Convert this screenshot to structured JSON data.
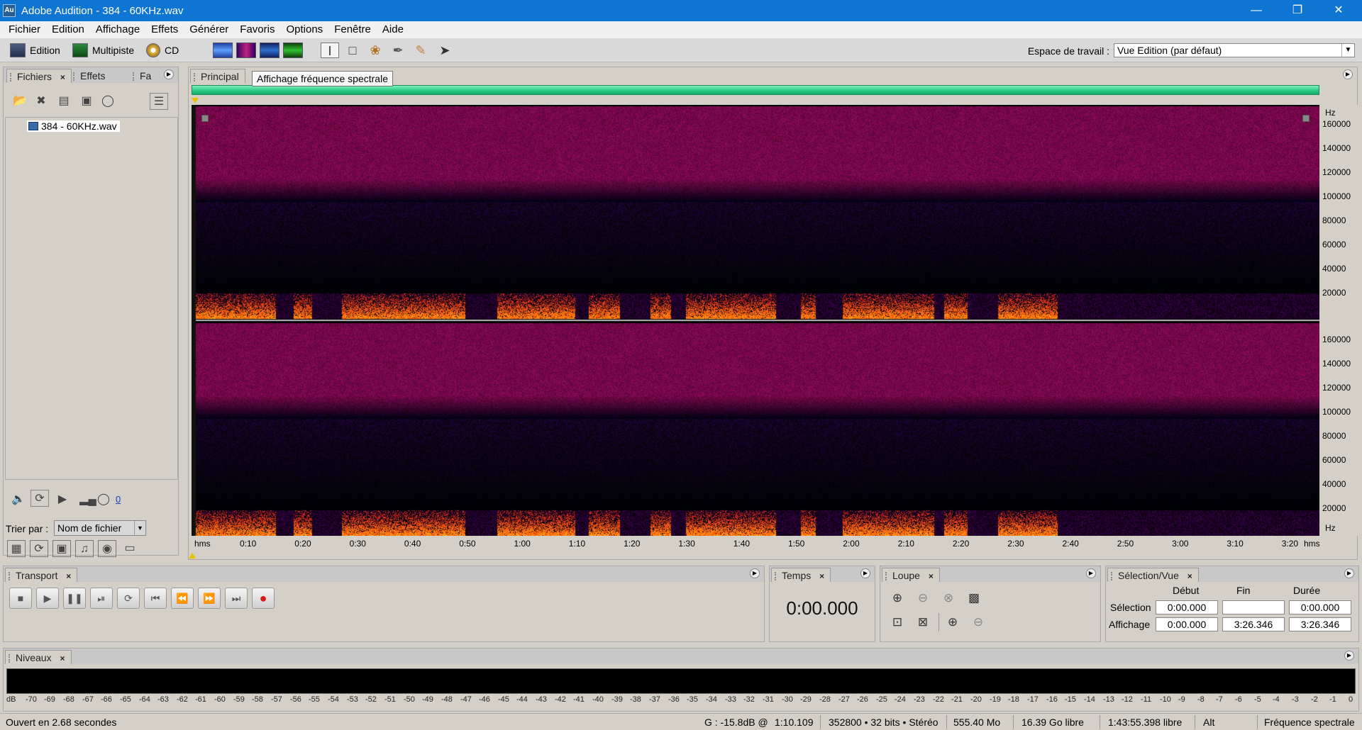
{
  "window": {
    "title": "Adobe Audition - 384 - 60KHz.wav",
    "app_icon": "Au"
  },
  "menu": [
    "Fichier",
    "Edition",
    "Affichage",
    "Effets",
    "Générer",
    "Favoris",
    "Options",
    "Fenêtre",
    "Aide"
  ],
  "toolbar": {
    "edition": "Edition",
    "multipiste": "Multipiste",
    "cd": "CD",
    "workspace_label": "Espace de travail :",
    "workspace_value": "Vue Edition (par défaut)"
  },
  "files_panel": {
    "tabs": [
      "Fichiers",
      "Effets",
      "Fa"
    ],
    "file": "384 - 60KHz.wav",
    "volume_value": "0",
    "sort_label": "Trier par :",
    "sort_value": "Nom de fichier"
  },
  "main_panel": {
    "tab": "Principal",
    "tooltip": "Affichage fréquence spectrale",
    "freq_unit": "Hz",
    "freq_ticks_top": [
      "160000",
      "140000",
      "120000",
      "100000",
      "80000",
      "60000",
      "40000",
      "20000"
    ],
    "freq_ticks_bottom": [
      "160000",
      "140000",
      "120000",
      "100000",
      "80000",
      "60000",
      "40000",
      "20000"
    ],
    "time_unit": "hms",
    "time_ticks": [
      "0:10",
      "0:20",
      "0:30",
      "0:40",
      "0:50",
      "1:00",
      "1:10",
      "1:20",
      "1:30",
      "1:40",
      "1:50",
      "2:00",
      "2:10",
      "2:20",
      "2:30",
      "2:40",
      "2:50",
      "3:00",
      "3:10",
      "3:20"
    ]
  },
  "transport": {
    "tab": "Transport"
  },
  "temps": {
    "tab": "Temps",
    "value": "0:00.000"
  },
  "loupe": {
    "tab": "Loupe"
  },
  "selection_panel": {
    "tab": "Sélection/Vue",
    "headers": [
      "Début",
      "Fin",
      "Durée"
    ],
    "rows": [
      {
        "label": "Sélection",
        "debut": "0:00.000",
        "fin": "",
        "duree": "0:00.000"
      },
      {
        "label": "Affichage",
        "debut": "0:00.000",
        "fin": "3:26.346",
        "duree": "3:26.346"
      }
    ]
  },
  "niveaux": {
    "tab": "Niveaux",
    "scale": [
      "dB",
      "-70",
      "-69",
      "-68",
      "-67",
      "-66",
      "-65",
      "-64",
      "-63",
      "-62",
      "-61",
      "-60",
      "-59",
      "-58",
      "-57",
      "-56",
      "-55",
      "-54",
      "-53",
      "-52",
      "-51",
      "-50",
      "-49",
      "-48",
      "-47",
      "-46",
      "-45",
      "-44",
      "-43",
      "-42",
      "-41",
      "-40",
      "-39",
      "-38",
      "-37",
      "-36",
      "-35",
      "-34",
      "-33",
      "-32",
      "-31",
      "-30",
      "-29",
      "-28",
      "-27",
      "-26",
      "-25",
      "-24",
      "-23",
      "-22",
      "-21",
      "-20",
      "-19",
      "-18",
      "-17",
      "-16",
      "-15",
      "-14",
      "-13",
      "-12",
      "-11",
      "-10",
      "-9",
      "-8",
      "-7",
      "-6",
      "-5",
      "-4",
      "-3",
      "-2",
      "-1",
      "0"
    ]
  },
  "status": {
    "left": "Ouvert en 2.68 secondes",
    "level": "G : -15.8dB @",
    "pos": "1:10.109",
    "format": "352800 • 32 bits • Stéréo",
    "size": "555.40 Mo",
    "free": "16.39 Go libre",
    "time_free": "1:43:55.398 libre",
    "key": "Alt",
    "view": "Fréquence spectrale"
  }
}
